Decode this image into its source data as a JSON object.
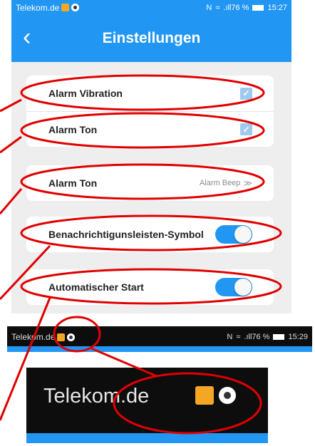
{
  "statusbar": {
    "carrier": "Telekom.de",
    "battery_text": "⁠.ıll76 %",
    "time": "15:27"
  },
  "appbar": {
    "back_icon": "‹",
    "title": "Einstellungen"
  },
  "cards": {
    "alarm_vibration_label": "Alarm Vibration",
    "alarm_ton_label": "Alarm Ton",
    "alarm_ton2_label": "Alarm Ton",
    "alarm_ton2_value": "Alarm Beep",
    "alarm_ton2_chevron": "≫",
    "notify_label": "Benachrichtigunsleisten-Symbol",
    "autostart_label": "Automatischer Start"
  },
  "zoom_bar": {
    "carrier": "Telekom.de",
    "battery_text": ".ıll76 %",
    "time": "15:29"
  },
  "zoom_big": {
    "carrier": "Telekom.de"
  },
  "colors": {
    "accent": "#2196f3",
    "annotation": "#e00000",
    "check_disabled": "#9fcaf0"
  },
  "icons": [
    "back-arrow-icon",
    "k-app-icon",
    "dial-icon",
    "nfc-icon",
    "wifi-icon",
    "signal-icon",
    "battery-icon",
    "checkbox-icon",
    "toggle-switch",
    "chevron-icon"
  ]
}
